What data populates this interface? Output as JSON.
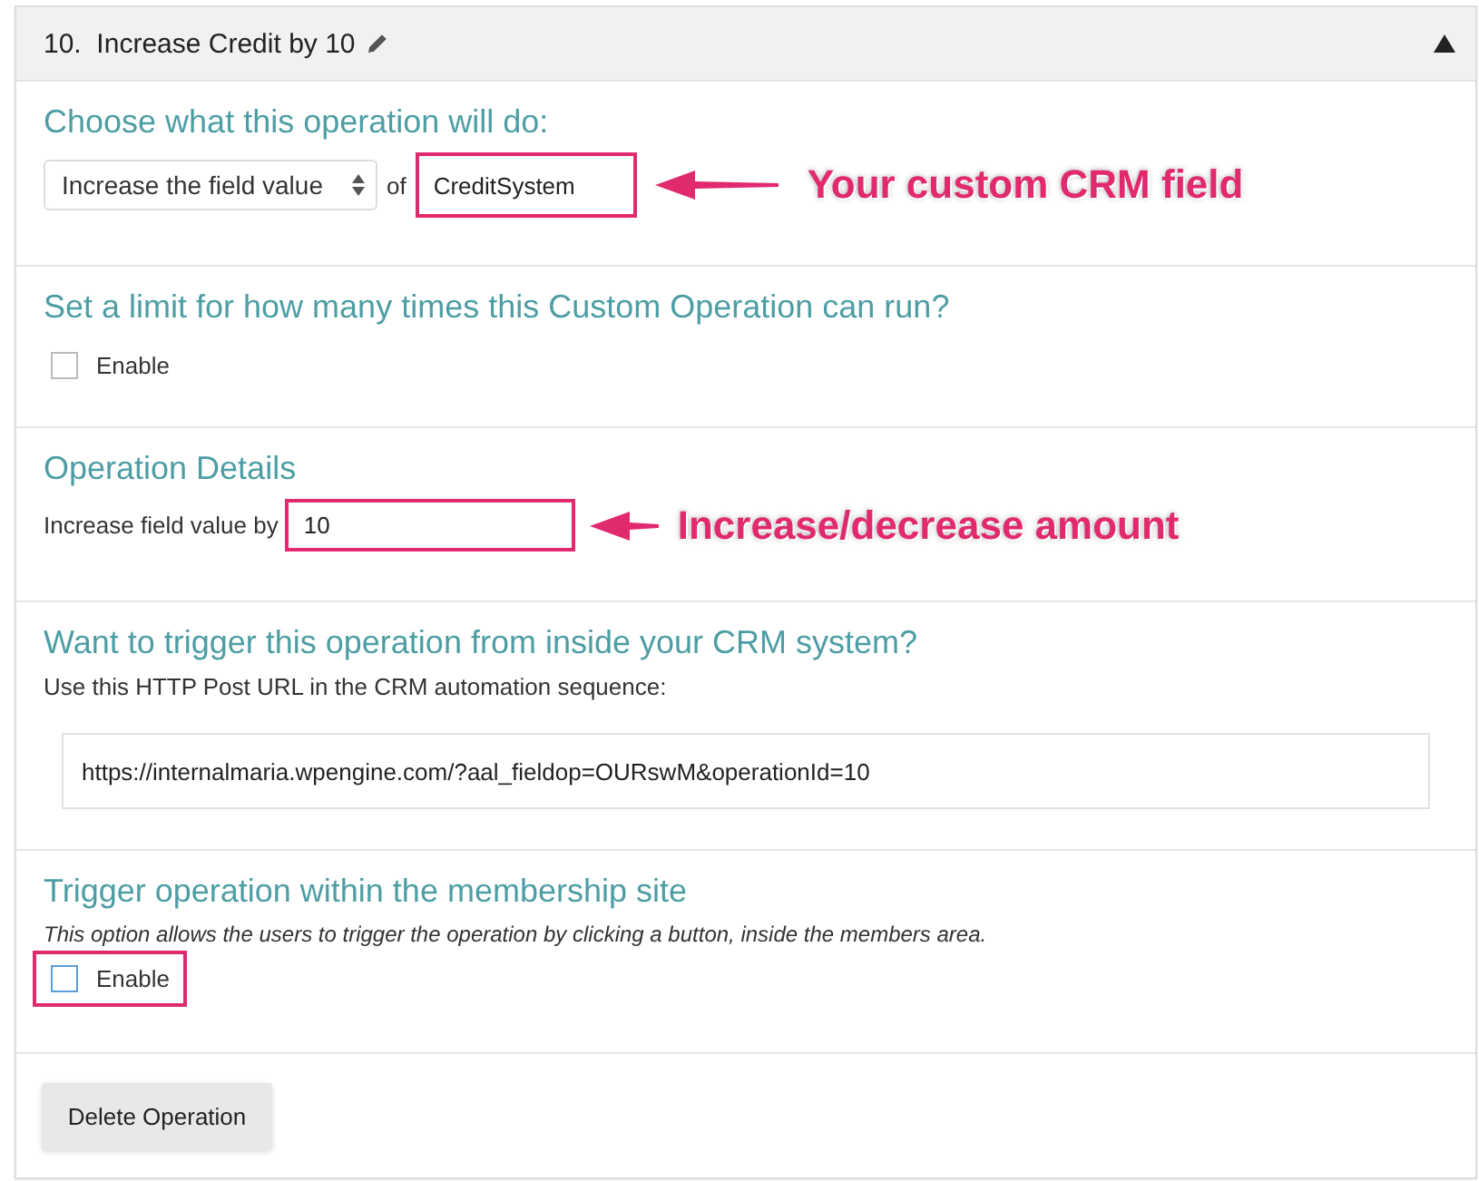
{
  "panel": {
    "number": "10.",
    "title": "Increase Credit by 10",
    "expanded": true
  },
  "sections": [
    {
      "kind": "operation",
      "heading": "Choose what this operation will do:",
      "select": "Increase the field value",
      "connector": "of",
      "field": {
        "value": "CreditSystem",
        "highlighted": true
      },
      "callout": "Your custom CRM field"
    },
    {
      "kind": "checkbox",
      "heading": "Set a limit for how many times this Custom Operation can run?",
      "checkbox": {
        "label": "Enable",
        "checked": false,
        "highlighted": false
      }
    },
    {
      "kind": "amount",
      "heading": "Operation Details",
      "label": "Increase field value by",
      "field": {
        "value": "10",
        "highlighted": true
      },
      "callout": "Increase/decrease amount"
    },
    {
      "kind": "url",
      "heading": "Want to trigger this operation from inside your CRM system?",
      "description": "Use this HTTP Post URL in the CRM automation sequence:",
      "url": "https://internalmaria.wpengine.com/?aal_fieldop=OURswM&operationId=10"
    },
    {
      "kind": "checkbox",
      "heading": "Trigger operation within the membership site",
      "note": "This option allows the users to trigger the operation by clicking a button, inside the members area.",
      "checkbox": {
        "label": "Enable",
        "checked": false,
        "highlighted": true
      }
    }
  ],
  "footer": {
    "button": "Delete Operation"
  }
}
